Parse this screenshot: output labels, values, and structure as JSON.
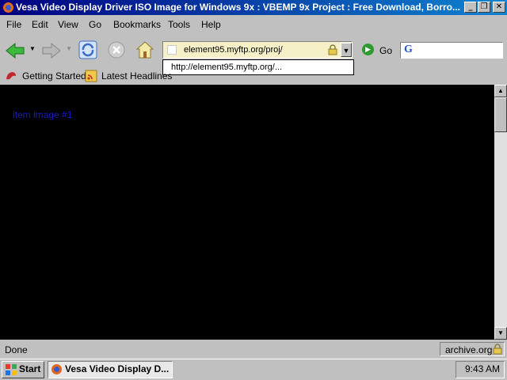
{
  "window": {
    "title": "Vesa Video Display Driver ISO Image for Windows 9x : VBEMP 9x Project : Free Download, Borro...",
    "caption_buttons": {
      "minimize": "_",
      "maximize": "❐",
      "close": "✕"
    }
  },
  "menu": {
    "items": [
      {
        "label": "File"
      },
      {
        "label": "Edit"
      },
      {
        "label": "View"
      },
      {
        "label": "Go"
      },
      {
        "label": "Bookmarks"
      },
      {
        "label": "Tools"
      },
      {
        "label": "Help"
      }
    ]
  },
  "toolbar": {
    "address_value": "element95.myftp.org/proj/",
    "address_suggestion": "http://element95.myftp.org/...",
    "go_label": "Go",
    "search_engine_glyph": "G"
  },
  "bookmarks": {
    "items": [
      {
        "label": "Getting Started"
      },
      {
        "label": "Latest Headlines"
      }
    ]
  },
  "content": {
    "text": "item image #1",
    "text_color": "#1a1acc",
    "background": "#000000"
  },
  "status": {
    "text": "Done",
    "site": "archive.org"
  },
  "taskbar": {
    "start_label": "Start",
    "task_label": "Vesa Video Display D...",
    "clock": "9:43 AM"
  },
  "colors": {
    "titlebar_start": "#000080",
    "titlebar_end": "#1084d0",
    "chrome": "#c0c0c0",
    "address_bg": "#f5f0c7"
  }
}
